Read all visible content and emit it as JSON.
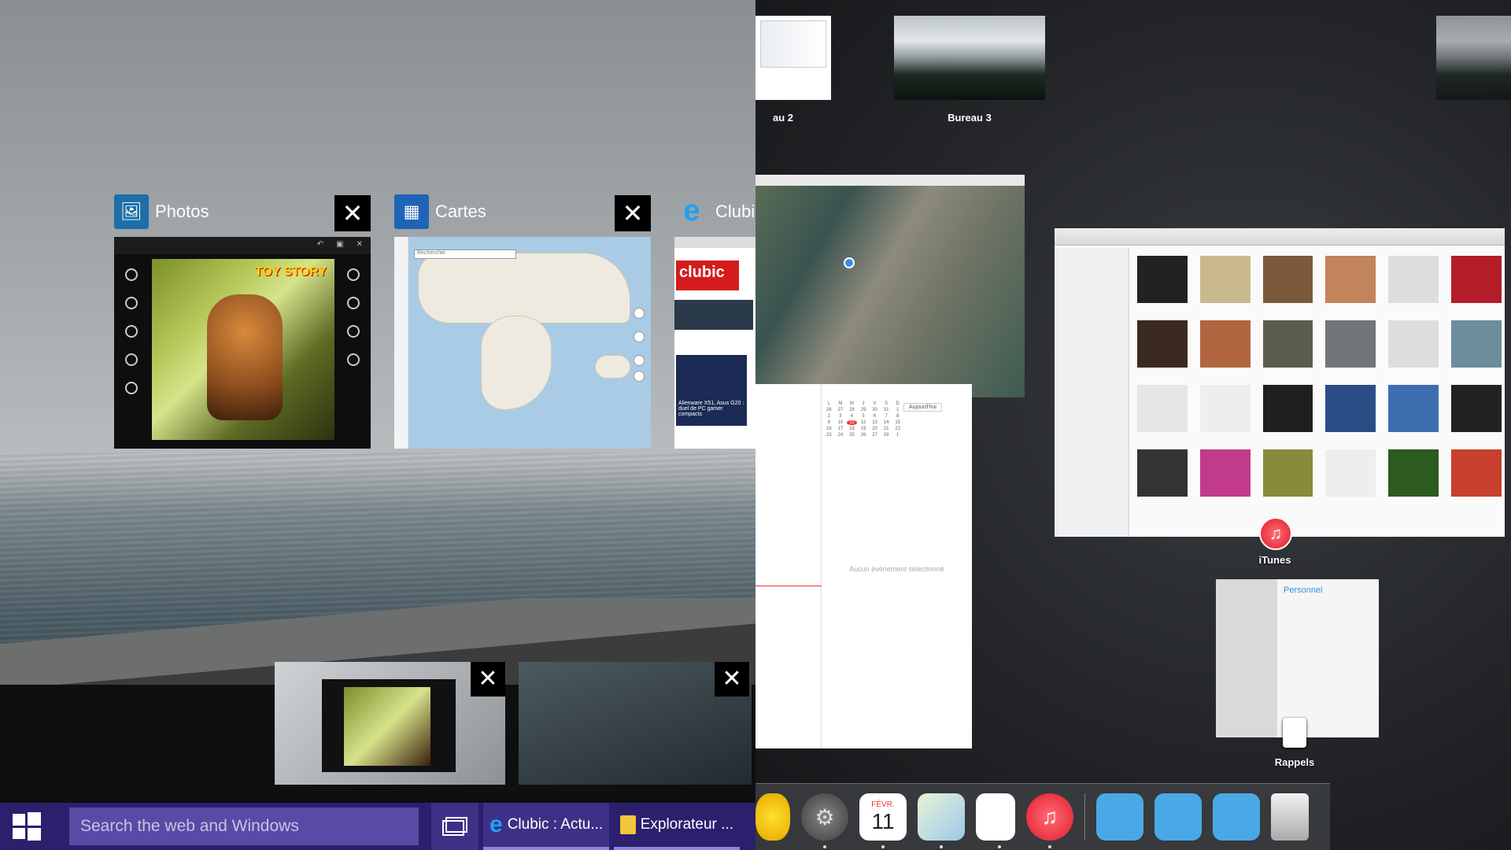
{
  "windows_taskview": {
    "apps": [
      {
        "title": "Photos",
        "icon": "photos-icon"
      },
      {
        "title": "Cartes",
        "icon": "maps-icon"
      },
      {
        "title": "Clubic",
        "icon": "internet-explorer-icon"
      }
    ],
    "close_glyph": "✕",
    "photos": {
      "toy_logo": "TOY STORY"
    },
    "maps": {
      "search_placeholder": "Rechercher"
    },
    "clubic": {
      "logo": "clubic",
      "headline": "Alienware X51, Asus G20 : duel de PC gamer compacts"
    }
  },
  "taskbar": {
    "search_placeholder": "Search the web and Windows",
    "apps": [
      {
        "label": "Clubic : Actu...",
        "icon": "internet-explorer-icon"
      },
      {
        "label": "Explorateur ...",
        "icon": "file-explorer-icon"
      }
    ]
  },
  "mission_control": {
    "spaces": [
      {
        "label": "au 2"
      },
      {
        "label": "Bureau 3"
      }
    ],
    "calendar": {
      "days_header": [
        "L",
        "M",
        "M",
        "J",
        "V",
        "S",
        "D"
      ],
      "days": [
        "26",
        "27",
        "28",
        "29",
        "30",
        "31",
        "1",
        "2",
        "3",
        "4",
        "5",
        "6",
        "7",
        "8",
        "9",
        "10",
        "11",
        "12",
        "13",
        "14",
        "15",
        "16",
        "17",
        "18",
        "19",
        "20",
        "21",
        "22",
        "23",
        "24",
        "25",
        "26",
        "27",
        "28",
        "1"
      ],
      "today": "11",
      "today_button": "Aujourd'hui",
      "empty_text": "Aucun événement sélectionné"
    },
    "app_labels": {
      "itunes": "iTunes",
      "reminders": "Rappels"
    },
    "reminders": {
      "list_title": "Personnel"
    },
    "dock_calendar": {
      "month": "FÉVR.",
      "day": "11"
    }
  },
  "colors": {
    "taskbar": "#2b1f6e",
    "search": "#5a4aa5",
    "accent_red": "#e33"
  }
}
